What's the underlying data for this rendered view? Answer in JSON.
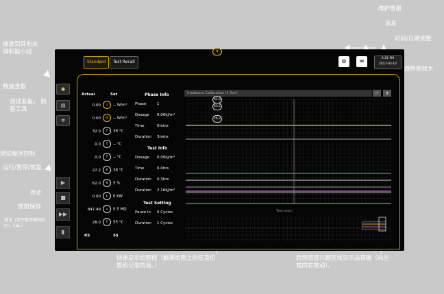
{
  "callouts": {
    "push_to_other": "推进到其他关键职能小组",
    "data_view": "数据查看",
    "test_prep": "测试准备。 顾客工具",
    "program_control": "测试程序控制",
    "run_pause": "运行/暂停/恢复",
    "stop": "停止",
    "save_advance": "提前保存",
    "test_note": "测试（用于暂停期间的Irr。Cal。）",
    "maint_alarm": "维护警报",
    "message": "消息",
    "time_date": "时间/日期调整",
    "trend_zoom": "趋势图放大",
    "quick_show": "快速显示绘图值（触摸绘图上的任意位置和记录的值。）",
    "trend_selector": "趋势图感兴趣区域显示选择器（向左或向右拖动）。"
  },
  "tabs": {
    "standard": "Standard",
    "recall": "Test Recall"
  },
  "clock": {
    "time": "5:21 PM",
    "date": "2017-03-12"
  },
  "columns": {
    "actual": "Actual",
    "set": "Set"
  },
  "readings": [
    {
      "actual": "0.00",
      "icon": "3",
      "set": "-- W/m²"
    },
    {
      "actual": "0.00",
      "icon": "W",
      "set": "-- W/m²"
    },
    {
      "actual": "32.0",
      "icon": "T",
      "set": "38 °C"
    },
    {
      "actual": "0.0",
      "icon": "T",
      "set": "-- °C"
    },
    {
      "actual": "0.0",
      "icon": "T",
      "set": "-- °C"
    },
    {
      "actual": "27.2",
      "icon": "A",
      "set": "38 °C"
    },
    {
      "actual": "62.0",
      "icon": "%",
      "set": "5 %"
    },
    {
      "actual": "0.00",
      "icon": "L",
      "set": "0 kW"
    },
    {
      "actual": "847.49",
      "icon": "=",
      "set": "0.5 MΩ"
    },
    {
      "actual": "28.0",
      "icon": "T",
      "set": "55 °C"
    }
  ],
  "footer": {
    "rs": "RS",
    "ss": "SS"
  },
  "phase_info": {
    "title": "Phase Info",
    "rows": [
      {
        "label": "Phase",
        "value": "1"
      },
      {
        "label": "Dosage",
        "value": "0.00kJ/m²"
      },
      {
        "label": "Time",
        "value": "0mins"
      },
      {
        "label": "Duration",
        "value": "3mins"
      }
    ]
  },
  "test_info": {
    "title": "Test Info",
    "rows": [
      {
        "label": "Dosage",
        "value": "0.00kJ/m²"
      },
      {
        "label": "Time",
        "value": "0.0hrs"
      },
      {
        "label": "Duration",
        "value": "0.3hrs"
      },
      {
        "label": "Duration",
        "value": "2.16kJ/m²"
      }
    ]
  },
  "test_setting": {
    "title": "Test Setting",
    "rows": [
      {
        "label": "Pause In",
        "value": "0 Cycles"
      },
      {
        "label": "Duration",
        "value": "1 Cycles"
      }
    ]
  },
  "chart": {
    "title": "Irradiance Calibration (1 Sun)",
    "xlabel": "Time (mins)",
    "markers": [
      "0",
      "61.8",
      "63.2",
      "26.2"
    ]
  }
}
